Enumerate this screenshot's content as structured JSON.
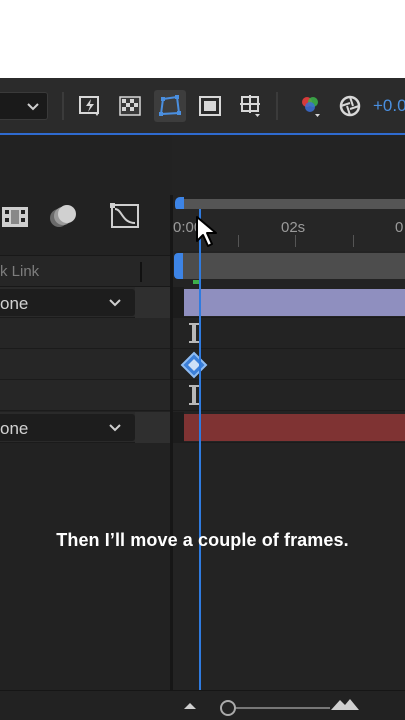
{
  "toolbar": {
    "value_readout": "+0.0",
    "icons": [
      "chevron-down-icon",
      "fast-preview-icon",
      "transparency-grid-icon",
      "mask-path-icon",
      "region-of-interest-icon",
      "guides-grid-icon",
      "color-channels-icon",
      "exposure-icon"
    ]
  },
  "timeline_header": {
    "column_label": "k Link"
  },
  "layers": [
    {
      "blend_value": "one"
    },
    {
      "blend_value": "one"
    }
  ],
  "ruler": {
    "labels": [
      "0:00",
      "02s",
      "0"
    ]
  },
  "caption": "Then I’ll move a couple of frames.",
  "colors": {
    "accent": "#2f7be0",
    "track_purple": "#8f8fbf",
    "track_red": "#7f3333",
    "keyframe_marker": "#3eae4a"
  }
}
